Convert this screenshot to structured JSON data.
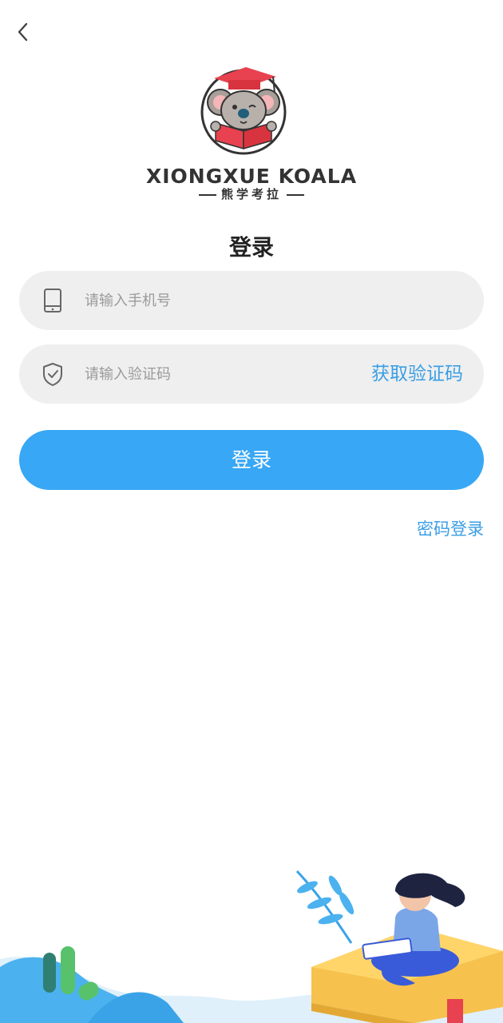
{
  "nav": {
    "back_icon": "chevron-left-icon"
  },
  "logo": {
    "title": "XIONGXUE KOALA",
    "subtitle": "熊学考拉"
  },
  "page": {
    "title": "登录"
  },
  "form": {
    "phone": {
      "placeholder": "请输入手机号",
      "value": "",
      "icon": "phone-icon"
    },
    "code": {
      "placeholder": "请输入验证码",
      "value": "",
      "icon": "shield-check-icon",
      "get_code_label": "获取验证码"
    },
    "submit_label": "登录",
    "password_login_label": "密码登录"
  },
  "colors": {
    "accent": "#38a7f5",
    "link": "#3a9ee6",
    "field_bg": "#efefef",
    "logo_red": "#e8414f"
  }
}
